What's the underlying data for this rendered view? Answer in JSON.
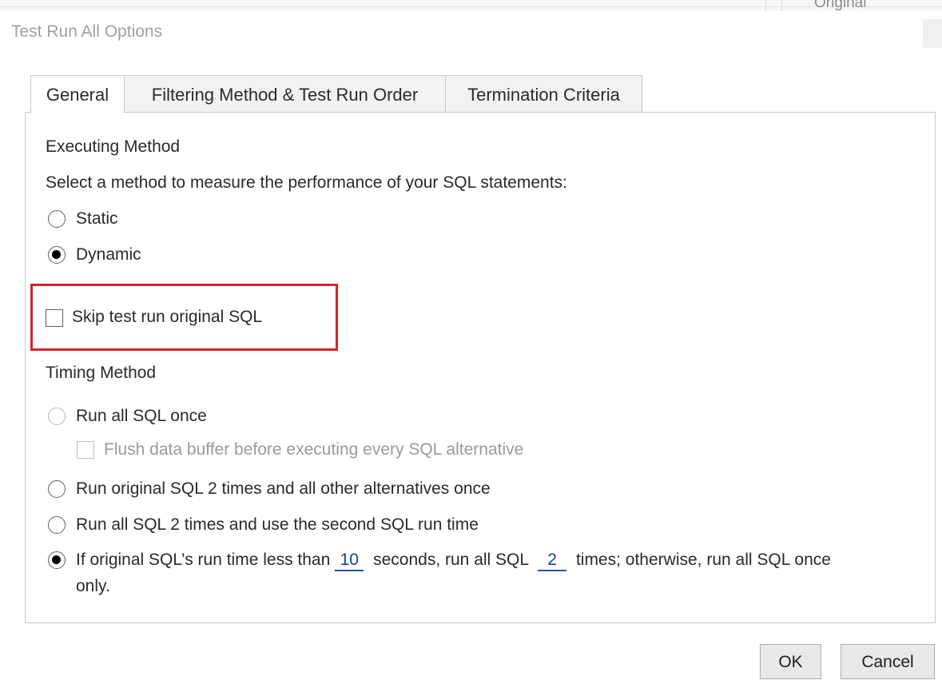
{
  "background": {
    "column_header": "Original"
  },
  "window": {
    "title": "Test Run All Options"
  },
  "tabs": [
    {
      "label": "General"
    },
    {
      "label": "Filtering Method & Test Run Order"
    },
    {
      "label": "Termination Criteria"
    }
  ],
  "executing_method": {
    "heading": "Executing Method",
    "description": "Select a method to measure the performance of your SQL statements:",
    "options": [
      {
        "label": "Static",
        "selected": false
      },
      {
        "label": "Dynamic",
        "selected": true
      }
    ]
  },
  "skip_test_run": {
    "label": "Skip test run original SQL",
    "checked": false
  },
  "timing_method": {
    "heading": "Timing Method",
    "run_all_once": {
      "label": "Run all SQL once",
      "selected": false
    },
    "flush_buffer": {
      "label": "Flush data buffer before executing every SQL alternative",
      "checked": false,
      "enabled": false
    },
    "run_original_twice": {
      "label": "Run original SQL 2 times and all other alternatives once",
      "selected": false
    },
    "run_all_twice": {
      "label": "Run all SQL 2 times and use the second SQL run time",
      "selected": false
    },
    "conditional": {
      "selected": true,
      "text_before": "If original SQL’s run time less than",
      "seconds_value": "10",
      "text_middle": "seconds, run all SQL",
      "times_value": "2",
      "text_after": "times; otherwise, run all SQL once",
      "text_wrap": "only."
    }
  },
  "buttons": {
    "ok": "OK",
    "cancel": "Cancel"
  },
  "colors": {
    "highlight": "#d6232b",
    "input_underline": "#2d4fa0"
  }
}
